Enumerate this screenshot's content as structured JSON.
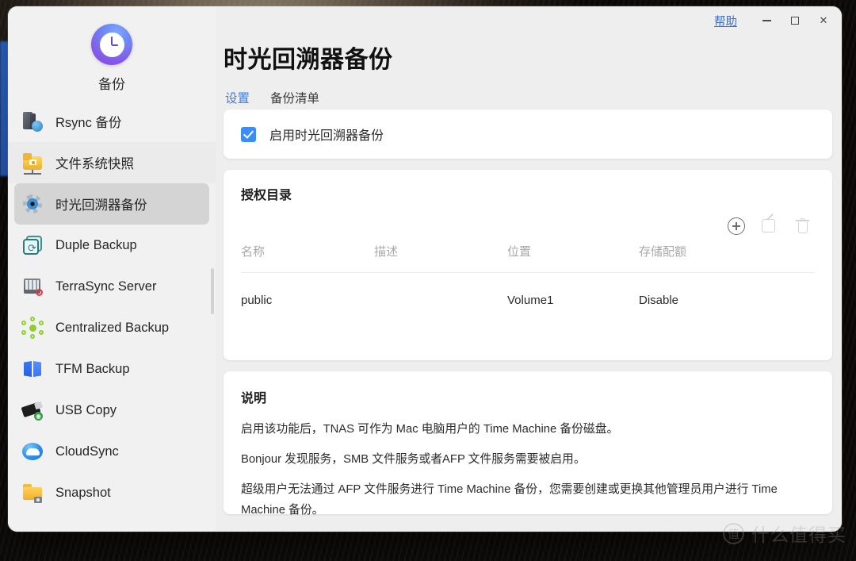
{
  "window": {
    "help_label": "帮助",
    "minimize_label": "−",
    "maximize_label": "□",
    "close_label": "✕",
    "accent_color": "#3b7fe0",
    "checkbox_color": "#3b8ef7"
  },
  "sidebar": {
    "app_name": "备份",
    "app_icon": "time-machine-clock-icon",
    "items": [
      {
        "label": "Rsync 备份",
        "icon": "server-globe-icon",
        "state": "normal"
      },
      {
        "label": "文件系统快照",
        "icon": "folder-camera-icon",
        "state": "alt"
      },
      {
        "label": "时光回溯器备份",
        "icon": "time-machine-icon",
        "state": "active"
      },
      {
        "label": "Duple Backup",
        "icon": "duple-sync-icon",
        "state": "normal"
      },
      {
        "label": "TerraSync Server",
        "icon": "nas-server-icon",
        "state": "normal"
      },
      {
        "label": "Centralized Backup",
        "icon": "hub-network-icon",
        "state": "normal"
      },
      {
        "label": "TFM Backup",
        "icon": "blue-book-icon",
        "state": "normal"
      },
      {
        "label": "USB Copy",
        "icon": "usb-stick-icon",
        "state": "normal"
      },
      {
        "label": "CloudSync",
        "icon": "cloud-icon",
        "state": "normal"
      },
      {
        "label": "Snapshot",
        "icon": "folder-snapshot-icon",
        "state": "normal"
      }
    ]
  },
  "main": {
    "title": "时光回溯器备份",
    "tabs": [
      {
        "label": "设置",
        "active": true
      },
      {
        "label": "备份清单",
        "active": false
      }
    ],
    "enable": {
      "label": "启用时光回溯器备份",
      "checked": true
    },
    "directories": {
      "heading": "授权目录",
      "actions": [
        {
          "name": "add-directory-button",
          "icon": "plus-circle-icon",
          "enabled": true
        },
        {
          "name": "edit-directory-button",
          "icon": "edit-pencil-icon",
          "enabled": false
        },
        {
          "name": "delete-directory-button",
          "icon": "trash-icon",
          "enabled": false
        }
      ],
      "columns": [
        "名称",
        "描述",
        "位置",
        "存储配额"
      ],
      "rows": [
        {
          "name": "public",
          "description": "",
          "location": "Volume1",
          "quota": "Disable"
        }
      ]
    },
    "description": {
      "heading": "说明",
      "lines": [
        "启用该功能后，TNAS 可作为 Mac 电脑用户的 Time Machine 备份磁盘。",
        "Bonjour 发现服务，SMB 文件服务或者AFP 文件服务需要被启用。",
        "超级用户无法通过 AFP 文件服务进行 Time Machine 备份，您需要创建或更换其他管理员用户进行 Time Machine 备份。"
      ]
    }
  },
  "watermark": {
    "logo_char": "值",
    "text": "什么值得买"
  }
}
